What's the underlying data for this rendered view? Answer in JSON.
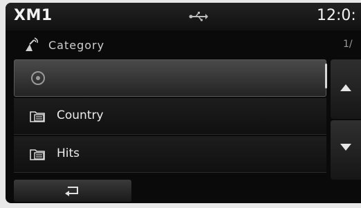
{
  "status": {
    "mode": "XM1",
    "usb_icon": "usb-icon",
    "time": "12:0:"
  },
  "header": {
    "category_icon": "satellite-antenna-icon",
    "category_label": "Category",
    "page_indicator": "1/"
  },
  "list": {
    "items": [
      {
        "label": "",
        "icon": "scan-icon",
        "selected": true
      },
      {
        "label": "Country",
        "icon": "folder-list-icon",
        "selected": false
      },
      {
        "label": "Hits",
        "icon": "folder-list-icon",
        "selected": false
      }
    ]
  },
  "controls": {
    "scroll_up_icon": "triangle-up-icon",
    "scroll_down_icon": "triangle-down-icon",
    "back_icon": "return-arrow-icon"
  }
}
